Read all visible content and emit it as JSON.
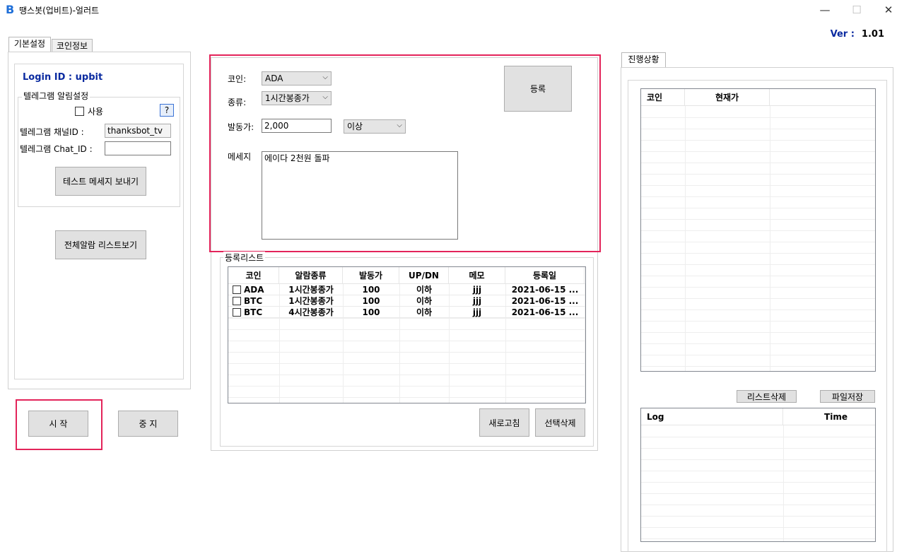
{
  "window": {
    "title": "땡스봇(업비트)-얼러트",
    "icon": "B",
    "minimize": "—",
    "maximize": "☐",
    "close": "✕"
  },
  "version": {
    "label": "Ver :",
    "value": "1.01"
  },
  "left_tabs": [
    {
      "label": "기본설정",
      "active": true
    },
    {
      "label": "코인정보",
      "active": false
    }
  ],
  "login": {
    "text": "Login ID : upbit"
  },
  "telegram": {
    "group_title": "텔레그램 알림설정",
    "use_label": "사용",
    "help_label": "?",
    "channel_label": "텔레그램  채널ID :",
    "channel_value": "thanksbot_tv",
    "chat_label": "텔레그램  Chat_ID :",
    "chat_value": "",
    "test_button": "테스트 메세지 보내기"
  },
  "all_alarm_button": "전체알람 리스트보기",
  "start_button": "시 작",
  "stop_button": "중 지",
  "form": {
    "coin_label": "코인:",
    "coin_value": "ADA",
    "type_label": "종류:",
    "type_value": "1시간봉종가",
    "trigger_label": "발동가:",
    "trigger_value": "2,000",
    "condition_value": "이상",
    "message_label": "메세지",
    "message_value": "에이다 2천원 돌파",
    "register_button": "등록"
  },
  "reg_list": {
    "group_title": "등록리스트",
    "columns": [
      "코인",
      "알람종류",
      "발동가",
      "UP/DN",
      "메모",
      "등록일"
    ],
    "rows": [
      {
        "coin": "ADA",
        "type": "1시간봉종가",
        "price": "100",
        "updn": "이하",
        "memo": "jjj",
        "date": "2021-06-15 ..."
      },
      {
        "coin": "BTC",
        "type": "1시간봉종가",
        "price": "100",
        "updn": "이하",
        "memo": "jjj",
        "date": "2021-06-15 ..."
      },
      {
        "coin": "BTC",
        "type": "4시간봉종가",
        "price": "100",
        "updn": "이하",
        "memo": "jjj",
        "date": "2021-06-15 ..."
      }
    ],
    "refresh_button": "새로고침",
    "delete_selected_button": "선택삭제"
  },
  "progress": {
    "tab_label": "진행상황",
    "columns": [
      "코인",
      "현재가"
    ],
    "list_delete_button": "리스트삭제",
    "file_save_button": "파일저장",
    "log_columns": [
      "Log",
      "Time"
    ]
  },
  "colors": {
    "highlight": "#e3245a",
    "login_text": "#0a2aa0",
    "icon": "#1f6fd8"
  }
}
